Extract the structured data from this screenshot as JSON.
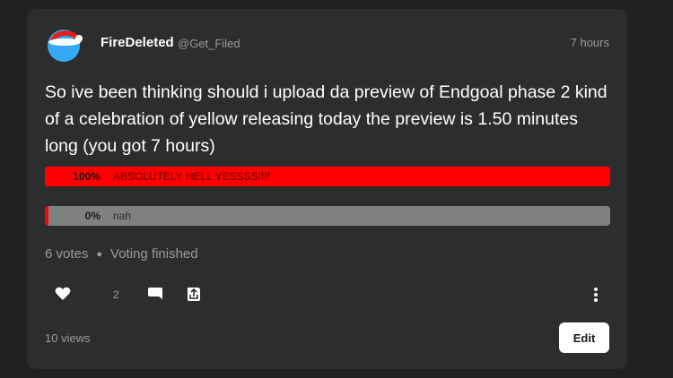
{
  "post": {
    "author": "FireDeleted",
    "handle": "@Get_Filed",
    "time": "7 hours",
    "text": "So ive been thinking should i upload da preview of Endgoal phase 2 kind of a celebration of yellow releasing today the preview is 1.50 minutes long (you got 7 hours)"
  },
  "poll": {
    "options": [
      {
        "percent_label": "100%",
        "label": "ABSOLUTELY HELL YESSSS!!!!",
        "percent": 100
      },
      {
        "percent_label": "0%",
        "label": "nah",
        "percent": 0
      }
    ],
    "votes": "6 votes",
    "status": "Voting finished"
  },
  "actions": {
    "like_count": "2"
  },
  "footer": {
    "views": "10 views",
    "edit_label": "Edit"
  },
  "colors": {
    "card_bg": "#2c2e2e",
    "poll_winner": "#ff0000",
    "poll_track": "#7f8181",
    "avatar_blue": "#36a9f5",
    "hat_red": "#e0201c"
  },
  "icons": {
    "avatar": "santa-hat-avatar-icon",
    "like": "heart-icon",
    "comment": "comment-bubble-icon",
    "share": "share-icon",
    "more": "more-vertical-icon"
  }
}
